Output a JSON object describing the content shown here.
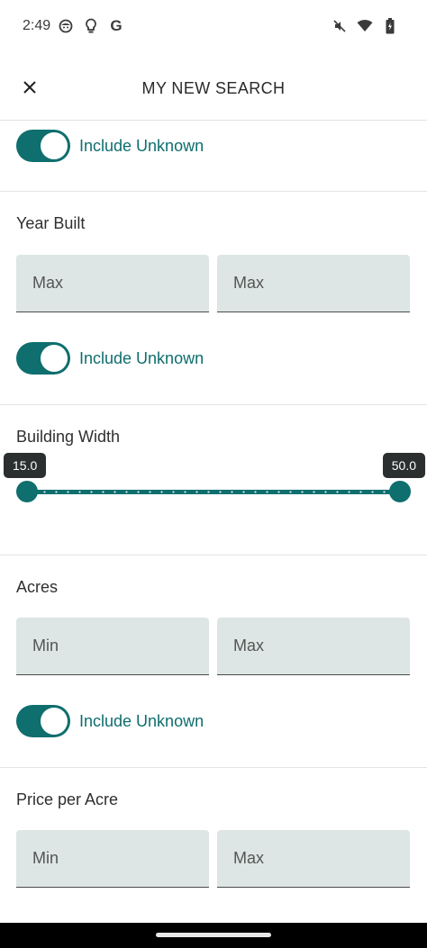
{
  "status_bar": {
    "time": "2:49",
    "left_icons": [
      "face-icon",
      "lightbulb-icon",
      "google-icon"
    ],
    "right_icons": [
      "mute-icon",
      "wifi-icon",
      "battery-icon"
    ],
    "google_glyph": "G"
  },
  "app_bar": {
    "title": "MY NEW SEARCH",
    "close_icon": "close-icon"
  },
  "sections": {
    "top_toggle": {
      "label": "Include Unknown",
      "on": true
    },
    "year_built": {
      "label": "Year Built",
      "field1_placeholder": "Max",
      "field2_placeholder": "Max",
      "toggle_label": "Include Unknown",
      "toggle_on": true
    },
    "building_width": {
      "label": "Building Width",
      "min_value": "15.0",
      "max_value": "50.0"
    },
    "acres": {
      "label": "Acres",
      "min_placeholder": "Min",
      "max_placeholder": "Max",
      "toggle_label": "Include Unknown",
      "toggle_on": true
    },
    "price_per_acre": {
      "label": "Price per Acre",
      "min_placeholder": "Min",
      "max_placeholder": "Max"
    }
  },
  "colors": {
    "accent": "#0f6e6e",
    "field_bg": "#dde6e4",
    "bubble_bg": "#2b2f2f"
  }
}
